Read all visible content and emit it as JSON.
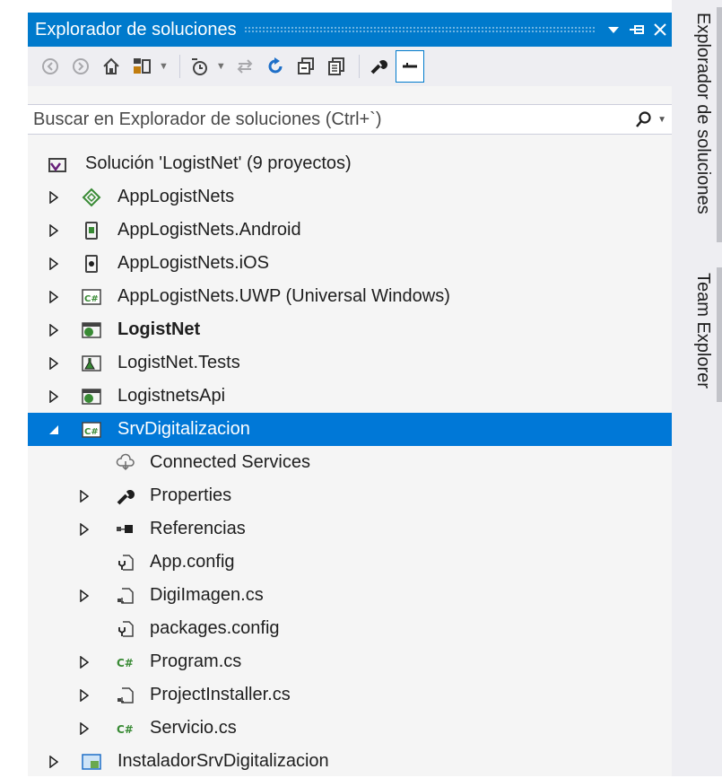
{
  "panel": {
    "title": "Explorador de soluciones",
    "title_buttons": [
      {
        "icon": "dropdown-arrow-icon",
        "glyph": "▾"
      },
      {
        "icon": "pin-icon",
        "glyph": "⊣"
      },
      {
        "icon": "close-icon",
        "glyph": "✕"
      }
    ]
  },
  "toolbar": {
    "items": [
      "back-icon",
      "forward-icon",
      "home-icon",
      "switch-views-icon",
      "pending-changes-filter-icon",
      "sync-icon",
      "refresh-icon",
      "collapse-all-icon",
      "show-all-files-icon",
      "properties-icon",
      "preview-selected-icon"
    ]
  },
  "search": {
    "placeholder": "Buscar en Explorador de soluciones (Ctrl+`)",
    "icon": "search-icon"
  },
  "tree": {
    "solution_label": "Solución 'LogistNet'  (9 proyectos)",
    "projects": [
      {
        "label": "AppLogistNets",
        "icon": "xamarin-forms-project-icon"
      },
      {
        "label": "AppLogistNets.Android",
        "icon": "android-project-icon"
      },
      {
        "label": "AppLogistNets.iOS",
        "icon": "ios-project-icon"
      },
      {
        "label": "AppLogistNets.UWP (Universal Windows)",
        "icon": "csharp-project-icon"
      },
      {
        "label": "LogistNet",
        "icon": "web-project-icon"
      },
      {
        "label": "LogistNet.Tests",
        "icon": "test-project-icon"
      },
      {
        "label": "LogistnetsApi",
        "icon": "web-project-icon"
      },
      {
        "label": "SrvDigitalizacion",
        "icon": "csharp-project-icon"
      }
    ],
    "children": [
      {
        "label": "Connected Services",
        "icon": "connected-services-icon"
      },
      {
        "label": "Properties",
        "icon": "wrench-icon"
      },
      {
        "label": "Referencias",
        "icon": "references-icon"
      },
      {
        "label": "App.config",
        "icon": "config-file-icon"
      },
      {
        "label": "DigiImagen.cs",
        "icon": "component-file-icon"
      },
      {
        "label": "packages.config",
        "icon": "config-file-icon"
      },
      {
        "label": "Program.cs",
        "icon": "csharp-file-icon"
      },
      {
        "label": "ProjectInstaller.cs",
        "icon": "component-file-icon"
      },
      {
        "label": "Servicio.cs",
        "icon": "csharp-file-icon"
      }
    ],
    "last_project": {
      "label": "InstaladorSrvDigitalizacion",
      "icon": "installer-project-icon"
    }
  },
  "side_tabs": {
    "solution_explorer": "Explorador de soluciones",
    "team_explorer": "Team Explorer"
  },
  "colors": {
    "accent": "#007acc",
    "selection": "#0078d7",
    "csharp_green": "#388a34"
  }
}
